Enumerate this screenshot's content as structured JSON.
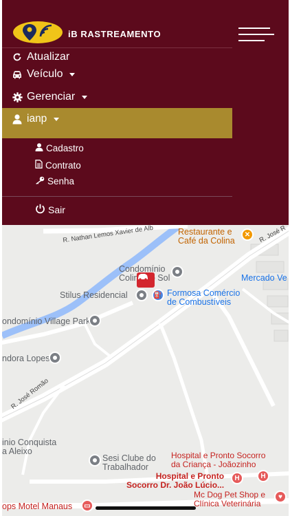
{
  "app": {
    "title": "iB RASTREAMENTO"
  },
  "menu": {
    "atualizar": "Atualizar",
    "veiculo": "Veículo",
    "gerenciar": "Gerenciar",
    "user": "ianp",
    "submenu": {
      "cadastro": "Cadastro",
      "contrato": "Contrato",
      "senha": "Senha"
    },
    "sair": "Sair"
  },
  "colors": {
    "menu_bg": "#5c0a1c",
    "active_bg": "#a98a2e",
    "logo": "#f0c419"
  },
  "map": {
    "labels": {
      "road_nathan": "R. Nathan Lemos Xavier de Alb",
      "restaurante": "Restaurante e\nCafé da Colina",
      "rua_jose_top": "R. José R",
      "condominio_sol": "Condomínio\nColina do Sol",
      "mercado": "Mercado Ve",
      "stilus": "Stilus Residencial",
      "formosa": "Formosa Comércio\nde Combustíveis",
      "village": "ondomínio Village Park",
      "ndora": "ndora Lopes",
      "rua_jose_romao": "R. José Romão",
      "conquista": "inio Conquista\na Aleixo",
      "sesi": "Sesi Clube do\nTrabalhador",
      "hospital_crianca": "Hospital e Pronto Socorro\nda Criança - Joãozinho",
      "hospital_joao": "Hospital e Pronto\nSocorro Dr. João Lúcio...",
      "mcdog": "Mc Dog Pet Shop e\nClínica Veterinária",
      "motel": "ops Motel Manaus"
    }
  }
}
